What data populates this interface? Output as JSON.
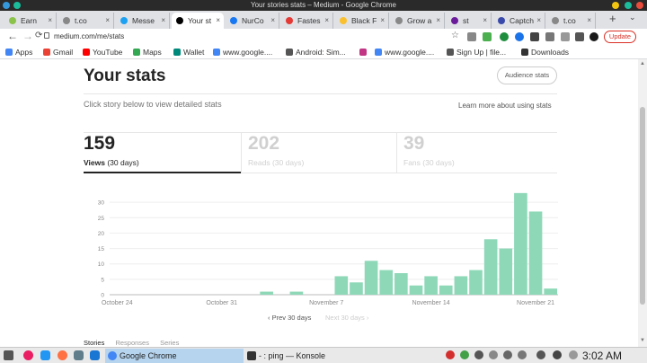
{
  "window": {
    "title": "Your stories stats – Medium - Google Chrome",
    "colors": {
      "close": "#e74c3c",
      "max": "#f1c40f",
      "min": "#1abc9c"
    }
  },
  "tabs": [
    {
      "label": "Earn",
      "icon": "earn-favicon",
      "color": "#8bc34a"
    },
    {
      "label": "t.co",
      "icon": "globe-favicon",
      "color": "#888888"
    },
    {
      "label": "Messe",
      "icon": "messages-favicon",
      "color": "#1da1f2"
    },
    {
      "label": "Your st",
      "icon": "medium-favicon",
      "color": "#000000",
      "active": true
    },
    {
      "label": "NurCo",
      "icon": "facebook-favicon",
      "color": "#1877f2"
    },
    {
      "label": "Fastes",
      "icon": "speedtest-favicon",
      "color": "#e53935"
    },
    {
      "label": "Black F",
      "icon": "blackfriday-favicon",
      "color": "#fbc02d"
    },
    {
      "label": "Grow a",
      "icon": "globe-favicon",
      "color": "#888888"
    },
    {
      "label": "st",
      "icon": "pencil-favicon",
      "color": "#6a1b9a"
    },
    {
      "label": "Captch",
      "icon": "shield-favicon",
      "color": "#3949ab"
    },
    {
      "label": "t.co",
      "icon": "globe-favicon",
      "color": "#888888"
    }
  ],
  "omnibox": {
    "url": "medium.com/me/stats",
    "update_label": "Update"
  },
  "bookmarks": [
    {
      "label": "Apps",
      "icon": "apps-grid-icon",
      "color": "#4285f4"
    },
    {
      "label": "Gmail",
      "icon": "gmail-icon",
      "color": "#ea4335"
    },
    {
      "label": "YouTube",
      "icon": "youtube-icon",
      "color": "#ff0000"
    },
    {
      "label": "Maps",
      "icon": "maps-icon",
      "color": "#34a853"
    },
    {
      "label": "Wallet",
      "icon": "wallet-icon",
      "color": "#00897b"
    },
    {
      "label": "www.google....",
      "icon": "google-icon",
      "color": "#4285f4"
    },
    {
      "label": "Android: Sim...",
      "icon": "globe-icon",
      "color": "#555555"
    },
    {
      "label": "",
      "icon": "instagram-icon",
      "color": "#c13584"
    },
    {
      "label": "www.google....",
      "icon": "google-icon",
      "color": "#4285f4"
    },
    {
      "label": "Sign Up | file...",
      "icon": "globe-icon",
      "color": "#555555"
    },
    {
      "label": "Downloads",
      "icon": "download-icon",
      "color": "#333333"
    }
  ],
  "page": {
    "title": "Your stats",
    "audience_button": "Audience stats",
    "hint": "Click story below to view detailed stats",
    "learn_more": "Learn more about using stats"
  },
  "stats": [
    {
      "value": "159",
      "label": "Views",
      "sub": "(30 days)",
      "active": true
    },
    {
      "value": "202",
      "label": "Reads",
      "sub": "(30 days)",
      "active": false
    },
    {
      "value": "39",
      "label": "Fans",
      "sub": "(30 days)",
      "active": false
    }
  ],
  "pager": {
    "prev": "Prev 30 days",
    "next": "Next 30 days"
  },
  "subtabs": [
    "Stories",
    "Responses",
    "Series"
  ],
  "chart_data": {
    "type": "bar",
    "color": "#8ed8b8",
    "ylim": [
      0,
      35
    ],
    "yticks": [
      0,
      5,
      10,
      15,
      20,
      25,
      30
    ],
    "xtick_labels": [
      {
        "label": "October 24",
        "index": 0
      },
      {
        "label": "October 31",
        "index": 7
      },
      {
        "label": "November 7",
        "index": 14
      },
      {
        "label": "November 14",
        "index": 21
      },
      {
        "label": "November 21",
        "index": 28
      }
    ],
    "values": [
      0,
      0,
      0,
      0,
      0,
      0,
      0,
      0,
      0,
      0,
      1,
      0,
      1,
      0,
      0,
      6,
      4,
      11,
      8,
      7,
      3,
      6,
      3,
      6,
      8,
      18,
      15,
      33,
      27,
      2
    ]
  },
  "taskbar": {
    "tasks": [
      {
        "label": "Google Chrome",
        "icon": "chrome-icon",
        "color": "#4285f4",
        "active": true
      },
      {
        "label": "- : ping — Konsole",
        "icon": "terminal-icon",
        "color": "#333333",
        "active": false
      }
    ],
    "clock": "3:02 AM"
  }
}
